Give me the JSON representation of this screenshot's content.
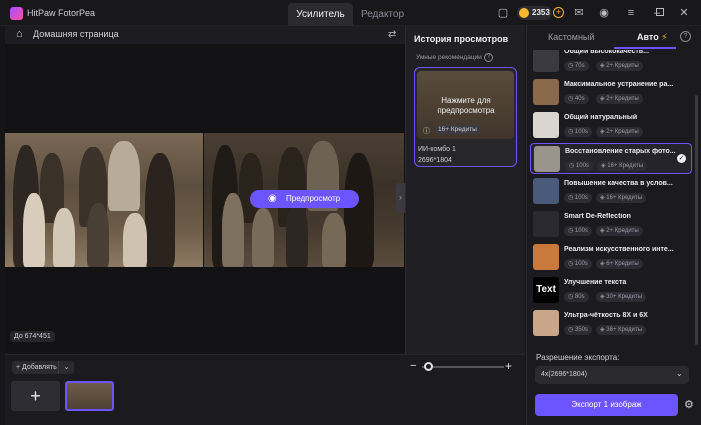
{
  "app": {
    "title": "HitPaw FotorPea"
  },
  "tabs": [
    {
      "label": "Усилитель"
    },
    {
      "label": "Редактор"
    }
  ],
  "header": {
    "credits": "2353"
  },
  "canvas": {
    "breadcrumb": "Домашняя страница",
    "preview_button": "Предпросмотр",
    "before_label": "До 674*451"
  },
  "bottom": {
    "add_button": "Добавлять",
    "add_tile": "+"
  },
  "history": {
    "title": "История просмотров",
    "subtitle": "Умные рекомендации",
    "card_hint": "Нажмите для предпросмотра",
    "card_credit": "16+ Кредиты",
    "model": "ИИ-комбо 1",
    "dims": "2696*1804"
  },
  "panel": {
    "tab_custom": "Кастомный",
    "tab_auto": "Авто",
    "models": [
      {
        "name": "Общий высококачеств...",
        "time": "70s",
        "credits": "2+ Кредиты",
        "color": "#3a3a40"
      },
      {
        "name": "Максимальное устранение ра...",
        "time": "40s",
        "credits": "2+ Кредиты",
        "color": "#8a6a4a"
      },
      {
        "name": "Общий натуральный",
        "time": "100s",
        "credits": "2+ Кредиты",
        "color": "#d9d5cf"
      },
      {
        "name": "Восстановление старых фото...",
        "time": "100s",
        "credits": "16+ Кредиты",
        "color": "#9a958c",
        "selected": true
      },
      {
        "name": "Повышение качества в услов...",
        "time": "100s",
        "credits": "16+ Кредиты",
        "color": "#4a5a7a"
      },
      {
        "name": "Smart De-Reflection",
        "time": "100s",
        "credits": "2+ Кредиты",
        "color": "#2a2a30"
      },
      {
        "name": "Реализм искусственного инте...",
        "time": "100s",
        "credits": "6+ Кредиты",
        "color": "#c97a3a"
      },
      {
        "name": "Улучшение текста",
        "time": "80s",
        "credits": "30+ Кредиты",
        "color": "#000000",
        "thumb_text": "Text"
      },
      {
        "name": "Ультра-чёткость 8X и 6X",
        "time": "350s",
        "credits": "36+ Кредиты",
        "color": "#c9a68a"
      }
    ],
    "resolution_label": "Разрешение экспорта:",
    "resolution_value": "4x(2696*1804)",
    "export_button": "Экспорт 1 изображ"
  },
  "colors": {
    "accent": "#6c55ff",
    "coin": "#f5b82e",
    "bg": "#161619"
  }
}
